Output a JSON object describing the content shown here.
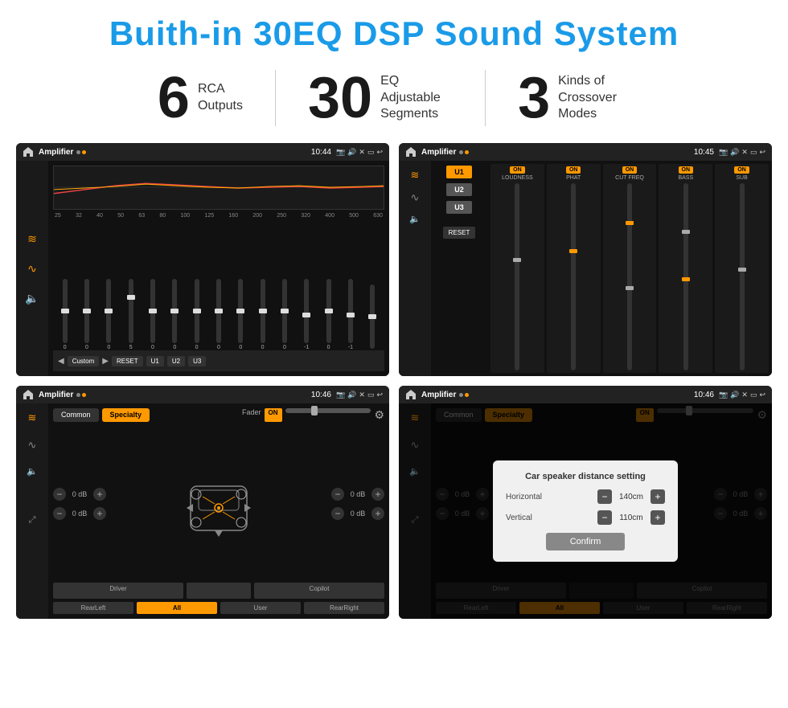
{
  "header": {
    "title": "Buith-in 30EQ DSP Sound System"
  },
  "stats": [
    {
      "number": "6",
      "text": "RCA\nOutputs"
    },
    {
      "number": "30",
      "text": "EQ Adjustable\nSegments"
    },
    {
      "number": "3",
      "text": "Kinds of\nCrossover Modes"
    }
  ],
  "screen1": {
    "app": "Amplifier",
    "time": "10:44",
    "eq_labels": [
      "25",
      "32",
      "40",
      "50",
      "63",
      "80",
      "100",
      "125",
      "160",
      "200",
      "250",
      "320",
      "400",
      "500",
      "630"
    ],
    "eq_values": [
      "0",
      "0",
      "0",
      "5",
      "0",
      "0",
      "0",
      "0",
      "0",
      "0",
      "0",
      "-1",
      "0",
      "-1",
      ""
    ],
    "buttons": [
      "Custom",
      "RESET",
      "U1",
      "U2",
      "U3"
    ]
  },
  "screen2": {
    "app": "Amplifier",
    "time": "10:45",
    "channels": [
      "LOUDNESS",
      "PHAT",
      "CUT FREQ",
      "BASS",
      "SUB"
    ],
    "u_buttons": [
      "U1",
      "U2",
      "U3"
    ],
    "reset": "RESET"
  },
  "screen3": {
    "app": "Amplifier",
    "time": "10:46",
    "tabs": [
      "Common",
      "Specialty"
    ],
    "fader_label": "Fader",
    "db_values": [
      "0 dB",
      "0 dB",
      "0 dB",
      "0 dB"
    ],
    "buttons": [
      "Driver",
      "",
      "Copilot",
      "RearLeft",
      "All",
      "User",
      "RearRight"
    ]
  },
  "screen4": {
    "app": "Amplifier",
    "time": "10:46",
    "dialog_title": "Car speaker distance setting",
    "horizontal_label": "Horizontal",
    "horizontal_value": "140cm",
    "vertical_label": "Vertical",
    "vertical_value": "110cm",
    "confirm": "Confirm",
    "db_right_top": "0 dB",
    "db_right_bottom": "0 dB",
    "buttons": [
      "Driver",
      "Copilot",
      "RearLeft",
      "User",
      "RearRight"
    ]
  }
}
